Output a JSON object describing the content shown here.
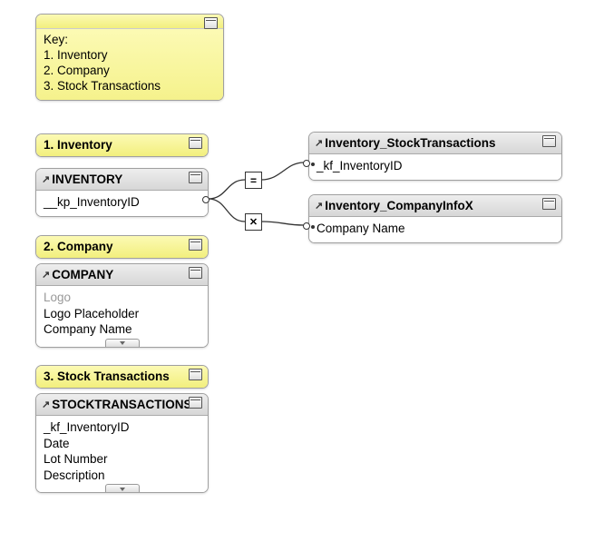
{
  "key_note": {
    "lines": [
      "Key:",
      "1. Inventory",
      "2. Company",
      "3. Stock Transactions"
    ]
  },
  "sections": {
    "inventory_label": "1. Inventory",
    "company_label": "2. Company",
    "stock_label": "3. Stock Transactions"
  },
  "tables": {
    "inventory": {
      "name": "INVENTORY",
      "fields": [
        "__kp_InventoryID"
      ]
    },
    "company": {
      "name": "COMPANY",
      "fields": [
        "Logo",
        "Logo Placeholder",
        "Company Name"
      ]
    },
    "stock": {
      "name": "STOCKTRANSACTIONS",
      "fields": [
        "_kf_InventoryID",
        "Date",
        "Lot Number",
        "Description"
      ]
    },
    "inv_st": {
      "name": "Inventory_StockTransactions",
      "fields": [
        "_kf_InventoryID"
      ]
    },
    "inv_cox": {
      "name": "Inventory_CompanyInfoX",
      "fields": [
        "Company Name"
      ]
    }
  },
  "operators": {
    "equal": "=",
    "cartesian": "✕"
  }
}
